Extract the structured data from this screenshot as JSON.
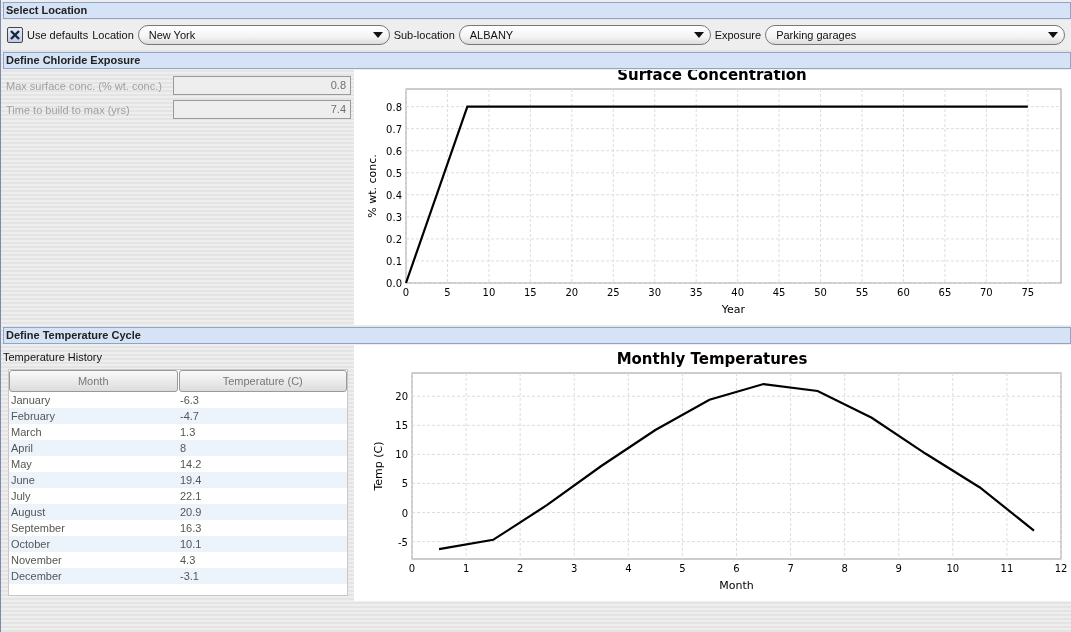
{
  "sections": [
    {
      "title": "Select Location"
    },
    {
      "title": "Define Chloride Exposure"
    },
    {
      "title": "Define Temperature Cycle"
    }
  ],
  "location": {
    "use_defaults": {
      "label": "Use defaults",
      "checked": true
    },
    "dropdowns": [
      {
        "label": "Location",
        "value": "New York"
      },
      {
        "label": "Sub-location",
        "value": "ALBANY"
      },
      {
        "label": "Exposure",
        "value": "Parking garages"
      }
    ]
  },
  "chloride": {
    "fields": [
      {
        "label": "Max surface conc. (% wt. conc.)",
        "value": "0.8",
        "disabled": true
      },
      {
        "label": "Time to build to max (yrs)",
        "value": "7.4",
        "disabled": true
      }
    ],
    "chart_data": {
      "type": "line",
      "title": "Surface Concentration",
      "xlabel": "Year",
      "ylabel": "% wt. conc.",
      "x": [
        0,
        7.4,
        75
      ],
      "series": [
        {
          "color": "#000000",
          "values": [
            0,
            0.8,
            0.8
          ]
        }
      ],
      "grid": true,
      "xlim": [
        0,
        79
      ],
      "ylim": [
        0,
        0.88
      ],
      "xticks": [
        0,
        5,
        10,
        15,
        20,
        25,
        30,
        35,
        40,
        45,
        50,
        55,
        60,
        65,
        70,
        75
      ],
      "yticks": [
        {
          "value": 0,
          "label": "0.0"
        },
        0.1,
        0.2,
        0.3,
        0.4,
        0.5,
        0.6,
        0.7,
        0.8
      ]
    }
  },
  "temperature": {
    "table_title": "Temperature History",
    "columns": [
      "Month",
      "Temperature (C)"
    ],
    "rows": [
      [
        "January",
        "-6.3"
      ],
      [
        "February",
        "-4.7"
      ],
      [
        "March",
        "1.3"
      ],
      [
        "April",
        "8"
      ],
      [
        "May",
        "14.2"
      ],
      [
        "June",
        "19.4"
      ],
      [
        "July",
        "22.1"
      ],
      [
        "August",
        "20.9"
      ],
      [
        "September",
        "16.3"
      ],
      [
        "October",
        "10.1"
      ],
      [
        "November",
        "4.3"
      ],
      [
        "December",
        "-3.1"
      ]
    ],
    "chart_data": {
      "type": "line",
      "title": "Monthly Temperatures",
      "xlabel": "Month",
      "ylabel": "Temp (C)",
      "x": [
        0.5,
        1.5,
        2.5,
        3.5,
        4.5,
        5.5,
        6.5,
        7.5,
        8.5,
        9.5,
        10.5,
        11.5
      ],
      "series": [
        {
          "color": "#000000",
          "values": [
            -6.3,
            -4.7,
            1.3,
            8,
            14.2,
            19.4,
            22.1,
            20.9,
            16.3,
            10.1,
            4.3,
            -3.1
          ]
        }
      ],
      "grid": true,
      "xlim": [
        0,
        12
      ],
      "ylim": [
        -8,
        24
      ],
      "xticks": [
        0,
        1,
        2,
        3,
        4,
        5,
        6,
        7,
        8,
        9,
        10,
        11,
        12
      ],
      "yticks": [
        -5,
        0,
        5,
        10,
        15,
        20
      ]
    }
  }
}
